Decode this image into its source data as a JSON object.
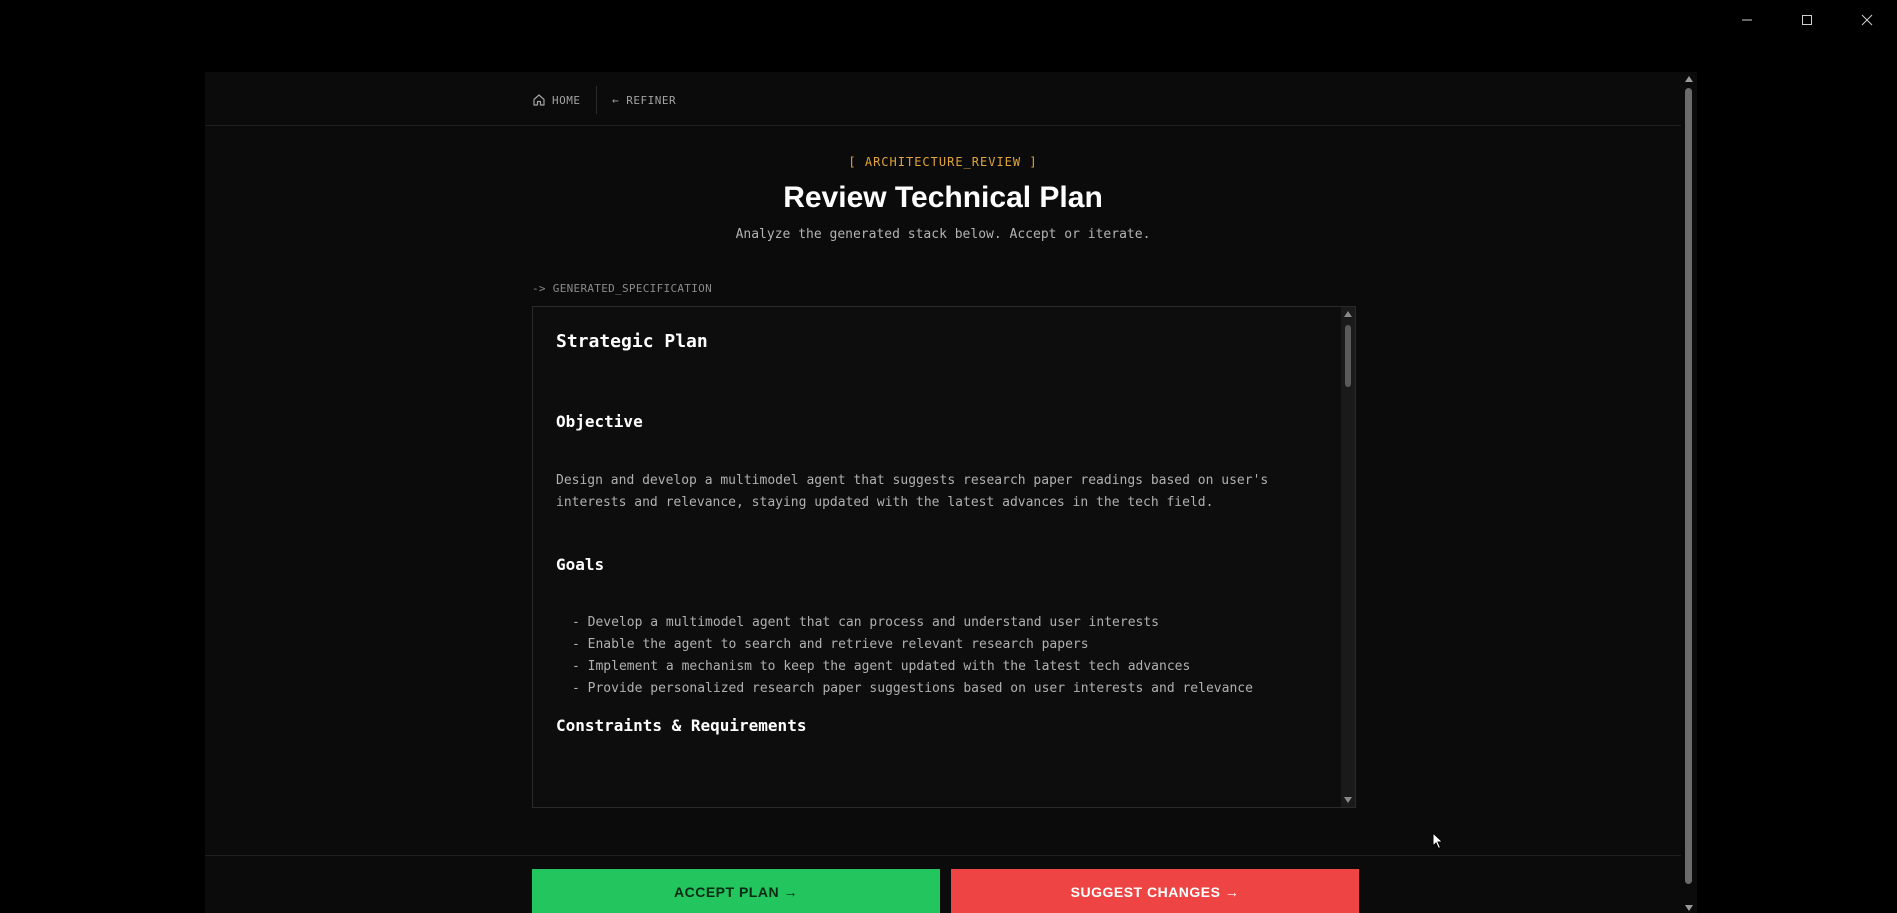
{
  "window": {
    "minimize_icon": "minimize-icon",
    "maximize_icon": "maximize-icon",
    "close_icon": "close-icon"
  },
  "nav": {
    "home_label": "HOME",
    "home_icon": "home-icon",
    "refiner_label": "← REFINER"
  },
  "header": {
    "eyebrow": "[ ARCHITECTURE_REVIEW ]",
    "title": "Review Technical Plan",
    "subtitle": "Analyze the generated stack below. Accept or iterate."
  },
  "spec": {
    "label": "-> GENERATED_SPECIFICATION",
    "heading": "Strategic Plan",
    "objective_heading": "Objective",
    "objective_text": "Design and develop a multimodel agent that suggests research paper readings based on user's interests and relevance, staying updated with the latest advances in the tech field.",
    "goals_heading": "Goals",
    "goals": [
      "- Develop a multimodel agent that can process and understand user interests",
      "- Enable the agent to search and retrieve relevant research papers",
      "- Implement a mechanism to keep the agent updated with the latest tech advances",
      "- Provide personalized research paper suggestions based on user interests and relevance"
    ],
    "constraints_heading": "Constraints & Requirements"
  },
  "actions": {
    "accept_label": "ACCEPT PLAN →",
    "suggest_label": "SUGGEST CHANGES →"
  },
  "colors": {
    "accent": "#e0a43a",
    "accept": "#22c55e",
    "suggest": "#ef4444"
  }
}
